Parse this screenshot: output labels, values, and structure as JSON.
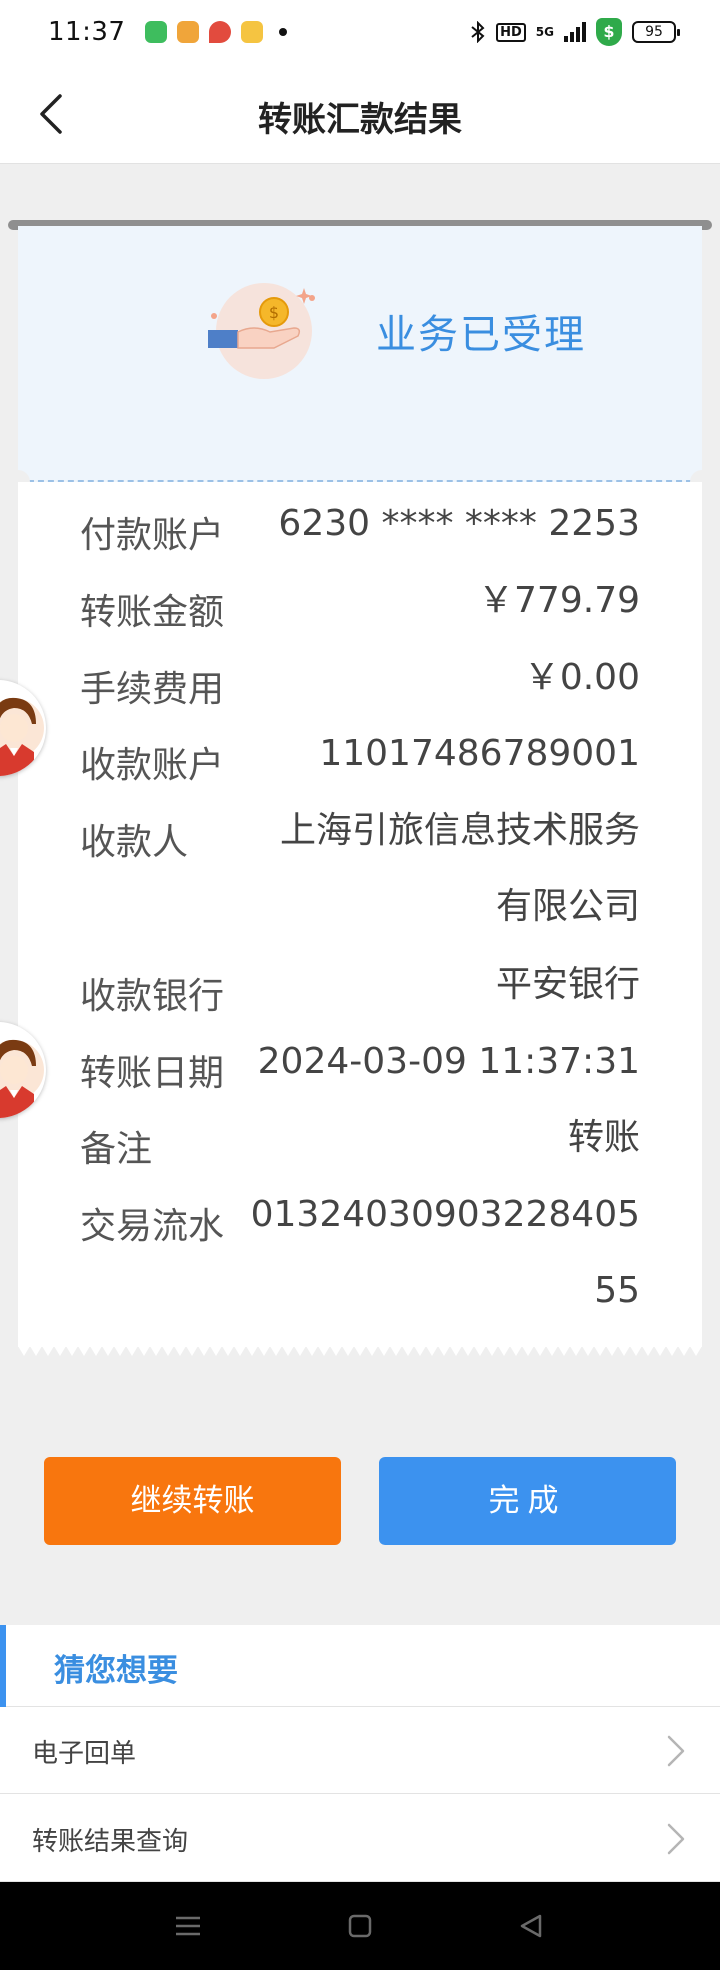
{
  "status_bar": {
    "time": "11:37",
    "network": "5G",
    "hd": "HD",
    "shield": "$",
    "battery": "95",
    "app_colors": [
      "#3ebd5e",
      "#f0a53a",
      "#e24b3e",
      "#f5c441"
    ]
  },
  "header": {
    "title": "转账汇款结果",
    "back_icon": "chevron-left-icon"
  },
  "result": {
    "status_text": "业务已受理",
    "icon": "hand-coin-icon",
    "accent_color": "#3a8ee0"
  },
  "details": [
    {
      "label": "付款账户",
      "value": "6230 **** **** 2253"
    },
    {
      "label": "转账金额",
      "value": "￥779.79"
    },
    {
      "label": "手续费用",
      "value": "￥0.00"
    },
    {
      "label": "收款账户",
      "value": "11017486789001"
    },
    {
      "label": "收款人",
      "value": "上海引旅信息技术服务有限公司"
    },
    {
      "label": "收款银行",
      "value": "平安银行"
    },
    {
      "label": "转账日期",
      "value": "2024-03-09 11:37:31"
    },
    {
      "label": "备注",
      "value": "转账"
    },
    {
      "label": "交易流水",
      "value": "0132403090322840555"
    }
  ],
  "actions": {
    "continue_label": "继续转账",
    "done_label": "完成",
    "continue_color": "#f8760e",
    "done_color": "#3c92ef"
  },
  "suggestions": {
    "title": "猜您想要",
    "items": [
      {
        "label": "电子回单"
      },
      {
        "label": "转账结果查询"
      }
    ]
  }
}
